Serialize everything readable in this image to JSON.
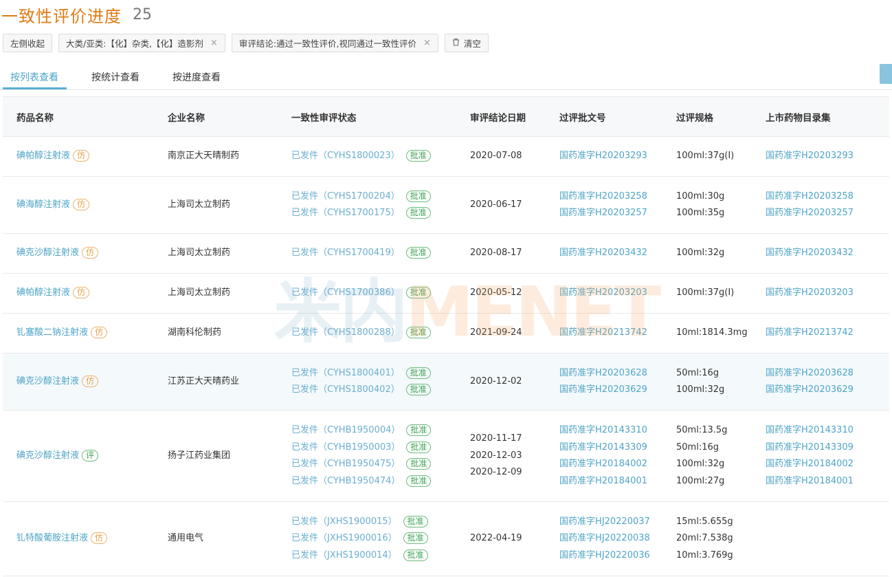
{
  "header": {
    "title": "一致性评价进度",
    "count": "25"
  },
  "filters": {
    "collapse_label": "左侧收起",
    "chip1": "大类/亚类:【化】杂类,【化】造影剂",
    "chip2": "审评结论:通过一致性评价,视同通过一致性评价",
    "close_glyph": "×",
    "clear_label": "清空"
  },
  "tabs": [
    "按列表查看",
    "按统计查看",
    "按进度查看"
  ],
  "columns": [
    "药品名称",
    "企业名称",
    "一致性审评状态",
    "审评结论日期",
    "过评批文号",
    "过评规格",
    "上市药物目录集"
  ],
  "approve_tag": "批准",
  "watermark": {
    "a": "米内",
    "b": "MENET"
  },
  "rows": [
    {
      "drug": "碘帕醇注射液",
      "tag": "仿",
      "company": "南京正大天晴制药",
      "status": [
        "已发件（CYHS1800023）"
      ],
      "dates": [
        "2020-07-08"
      ],
      "approvals": [
        "国药准字H20203293"
      ],
      "specs": [
        "100ml:37g(I)"
      ],
      "catalog": [
        "国药准字H20203293"
      ]
    },
    {
      "drug": "碘海醇注射液",
      "tag": "仿",
      "company": "上海司太立制药",
      "status": [
        "已发件（CYHS1700204）",
        "已发件（CYHS1700175）"
      ],
      "dates": [
        "2020-06-17"
      ],
      "approvals": [
        "国药准字H20203258",
        "国药准字H20203257"
      ],
      "specs": [
        "100ml:30g",
        "100ml:35g"
      ],
      "catalog": [
        "国药准字H20203258",
        "国药准字H20203257"
      ]
    },
    {
      "drug": "碘克沙醇注射液",
      "tag": "仿",
      "company": "上海司太立制药",
      "status": [
        "已发件（CYHS1700419）"
      ],
      "dates": [
        "2020-08-17"
      ],
      "approvals": [
        "国药准字H20203432"
      ],
      "specs": [
        "100ml:32g"
      ],
      "catalog": [
        "国药准字H20203432"
      ]
    },
    {
      "drug": "碘帕醇注射液",
      "tag": "仿",
      "company": "上海司太立制药",
      "status": [
        "已发件（CYHS1700386）"
      ],
      "dates": [
        "2020-05-12"
      ],
      "approvals": [
        "国药准字H20203203"
      ],
      "specs": [
        "100ml:37g(I)"
      ],
      "catalog": [
        "国药准字H20203203"
      ]
    },
    {
      "drug": "钆塞酸二钠注射液",
      "tag": "仿",
      "company": "湖南科伦制药",
      "status": [
        "已发件（CYHS1800288）"
      ],
      "dates": [
        "2021-09-24"
      ],
      "approvals": [
        "国药准字H20213742"
      ],
      "specs": [
        "10ml:1814.3mg"
      ],
      "catalog": [
        "国药准字H20213742"
      ]
    },
    {
      "drug": "碘克沙醇注射液",
      "tag": "仿",
      "company": "江苏正大天晴药业",
      "status": [
        "已发件（CYHS1800401）",
        "已发件（CYHS1800402）"
      ],
      "dates": [
        "2020-12-02"
      ],
      "approvals": [
        "国药准字H20203628",
        "国药准字H20203629"
      ],
      "specs": [
        "50ml:16g",
        "100ml:32g"
      ],
      "catalog": [
        "国药准字H20203628",
        "国药准字H20203629"
      ]
    },
    {
      "drug": "碘克沙醇注射液",
      "tag": "评",
      "company": "扬子江药业集团",
      "status": [
        "已发件（CYHB1950004）",
        "已发件（CYHB1950003）",
        "已发件（CYHB1950475）",
        "已发件（CYHB1950474）"
      ],
      "dates": [
        "2020-11-17",
        "2020-12-03",
        "2020-12-09"
      ],
      "approvals": [
        "国药准字H20143310",
        "国药准字H20143309",
        "国药准字H20184002",
        "国药准字H20184001"
      ],
      "specs": [
        "50ml:13.5g",
        "50ml:16g",
        "100ml:32g",
        "100ml:27g"
      ],
      "catalog": [
        "国药准字H20143310",
        "国药准字H20143309",
        "国药准字H20184002",
        "国药准字H20184001"
      ]
    },
    {
      "drug": "钆特酸葡胺注射液",
      "tag": "仿",
      "company": "通用电气",
      "status": [
        "已发件（JXHS1900015）",
        "已发件（JXHS1900016）",
        "已发件（JXHS1900014）"
      ],
      "dates": [
        "2022-04-19"
      ],
      "approvals": [
        "国药准字HJ20220037",
        "国药准字HJ20220038",
        "国药准字HJ20220036"
      ],
      "specs": [
        "15ml:5.655g",
        "20ml:7.538g",
        "10ml:3.769g"
      ],
      "catalog": []
    }
  ]
}
